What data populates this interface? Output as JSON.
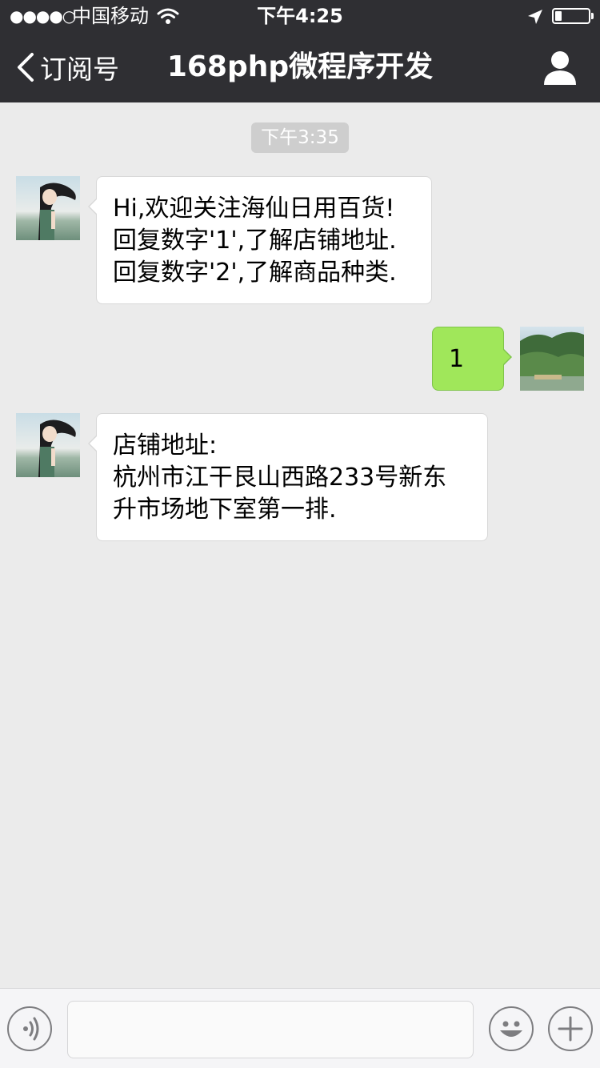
{
  "status_bar": {
    "signal": "●●●●○",
    "carrier": "中国移动",
    "time": "下午4:25"
  },
  "nav": {
    "back_label": "订阅号",
    "title": "168php微程序开发"
  },
  "chat": {
    "timestamp": "下午3:35",
    "messages": [
      {
        "direction": "incoming",
        "lines": [
          "Hi,欢迎关注海仙日用百货!",
          "回复数字'1',了解店铺地址.",
          "回复数字'2',了解商品种类."
        ]
      },
      {
        "direction": "outgoing",
        "lines": [
          "1"
        ]
      },
      {
        "direction": "incoming",
        "lines": [
          "店铺地址:",
          "杭州市江干艮山西路233号新东",
          "升市场地下室第一排."
        ]
      }
    ]
  },
  "input_bar": {
    "value": "",
    "placeholder": ""
  },
  "icons": {
    "back": "chevron-left-icon",
    "profile": "person-icon",
    "voice": "voice-icon",
    "emoji": "emoji-icon",
    "more": "plus-icon"
  },
  "colors": {
    "nav_bg": "#2f2f33",
    "chat_bg": "#ebebeb",
    "outgoing_bubble": "#a0e75a",
    "incoming_bubble": "#ffffff"
  }
}
